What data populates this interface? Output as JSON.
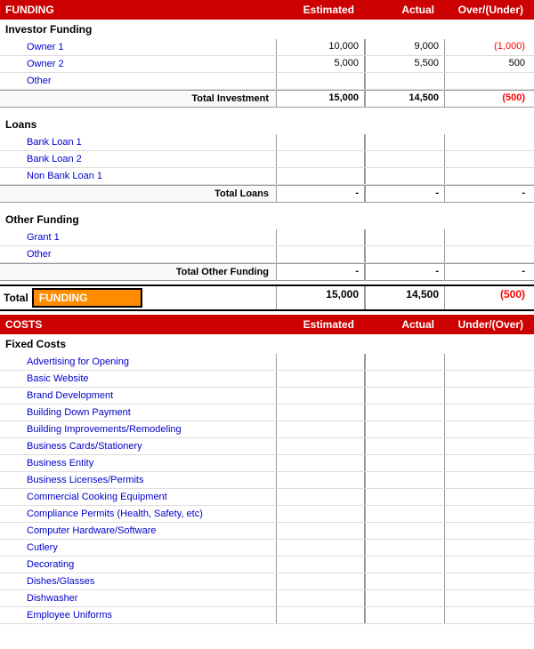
{
  "funding": {
    "header": {
      "title": "FUNDING",
      "col1": "Estimated",
      "col2": "Actual",
      "col3": "Over/(Under)"
    },
    "investor_funding": {
      "label": "Investor Funding",
      "rows": [
        {
          "name": "Owner 1",
          "estimated": "10,000",
          "actual": "9,000",
          "over_under": "(1,000)",
          "over_under_red": true
        },
        {
          "name": "Owner 2",
          "estimated": "5,000",
          "actual": "5,500",
          "over_under": "500",
          "over_under_red": false
        },
        {
          "name": "Other",
          "estimated": "",
          "actual": "",
          "over_under": "",
          "over_under_red": false
        }
      ],
      "total_label": "Total Investment",
      "total_estimated": "15,000",
      "total_actual": "14,500",
      "total_over_under": "(500)",
      "total_red": true
    },
    "loans": {
      "label": "Loans",
      "rows": [
        {
          "name": "Bank Loan 1",
          "estimated": "",
          "actual": "",
          "over_under": ""
        },
        {
          "name": "Bank Loan 2",
          "estimated": "",
          "actual": "",
          "over_under": ""
        },
        {
          "name": "Non Bank Loan 1",
          "estimated": "",
          "actual": "",
          "over_under": ""
        }
      ],
      "total_label": "Total Loans",
      "total_estimated": "-",
      "total_actual": "-",
      "total_over_under": "-"
    },
    "other_funding": {
      "label": "Other Funding",
      "rows": [
        {
          "name": "Grant 1",
          "estimated": "",
          "actual": "",
          "over_under": ""
        },
        {
          "name": "Other",
          "estimated": "",
          "actual": "",
          "over_under": ""
        }
      ],
      "total_label": "Total Other Funding",
      "total_estimated": "-",
      "total_actual": "-",
      "total_over_under": "-"
    },
    "grand_total": {
      "prefix": "Total",
      "label": "FUNDING",
      "estimated": "15,000",
      "actual": "14,500",
      "over_under": "(500)",
      "over_under_red": true
    }
  },
  "costs": {
    "header": {
      "title": "COSTS",
      "col1": "Estimated",
      "col2": "Actual",
      "col3": "Under/(Over)"
    },
    "fixed_costs": {
      "label": "Fixed Costs",
      "rows": [
        {
          "name": "Advertising for Opening",
          "blue": true
        },
        {
          "name": "Basic Website",
          "blue": true
        },
        {
          "name": "Brand Development",
          "blue": true
        },
        {
          "name": "Building Down Payment",
          "blue": true
        },
        {
          "name": "Building Improvements/Remodeling",
          "blue": true
        },
        {
          "name": "Business Cards/Stationery",
          "blue": true
        },
        {
          "name": "Business Entity",
          "blue": true
        },
        {
          "name": "Business Licenses/Permits",
          "blue": true
        },
        {
          "name": "Commercial Cooking Equipment",
          "blue": true
        },
        {
          "name": "Compliance Permits (Health, Safety, etc)",
          "blue": true
        },
        {
          "name": "Computer Hardware/Software",
          "blue": true
        },
        {
          "name": "Cutlery",
          "blue": true
        },
        {
          "name": "Decorating",
          "blue": true
        },
        {
          "name": "Dishes/Glasses",
          "blue": true
        },
        {
          "name": "Dishwasher",
          "blue": true
        },
        {
          "name": "Employee Uniforms",
          "blue": true
        }
      ]
    }
  }
}
